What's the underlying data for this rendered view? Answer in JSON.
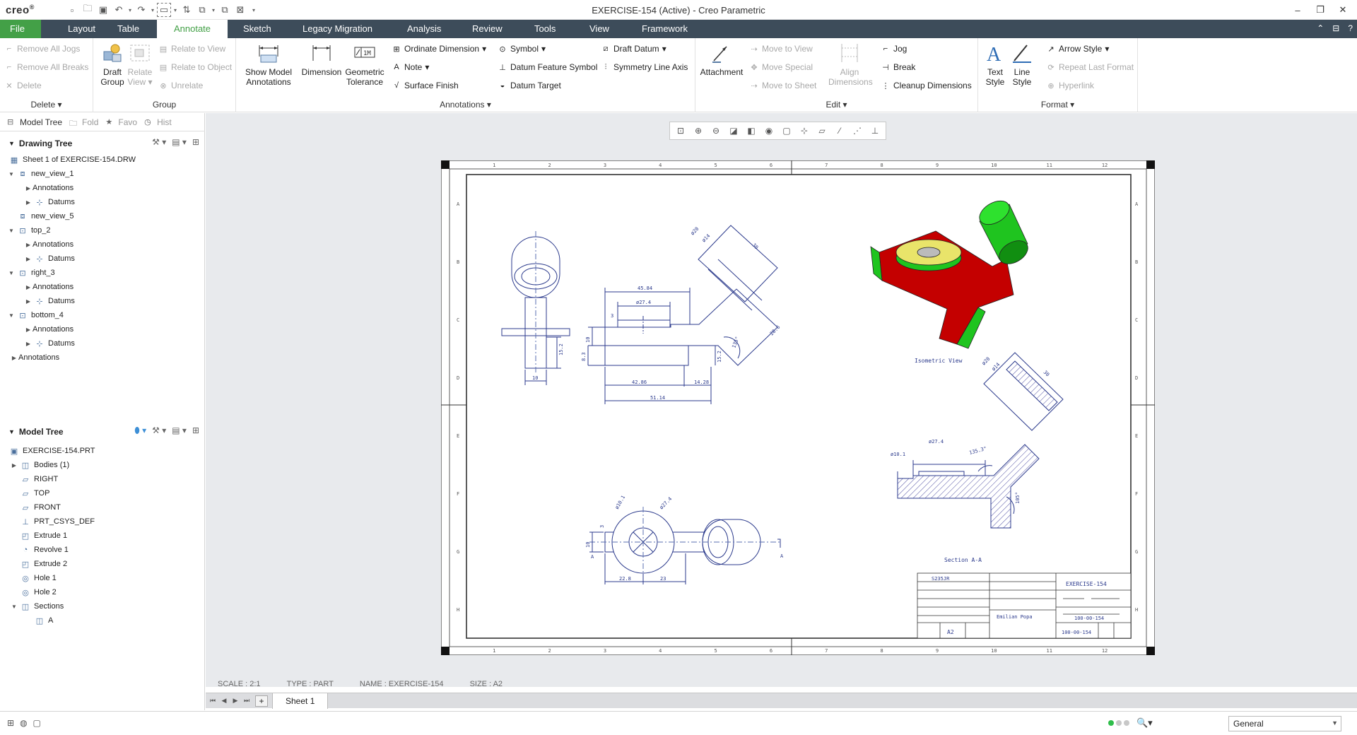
{
  "app": {
    "logo": "creo",
    "window_title": "EXERCISE-154 (Active) - Creo Parametric",
    "minimize": "–",
    "restore": "❐",
    "close": "✕"
  },
  "tabs": [
    "File",
    "Layout",
    "Table",
    "Annotate",
    "Sketch",
    "Legacy Migration",
    "Analysis",
    "Review",
    "Tools",
    "View",
    "Framework"
  ],
  "ribbon": {
    "delete_group": {
      "label": "Delete",
      "remove_all_jogs": "Remove All Jogs",
      "remove_all_breaks": "Remove All Breaks",
      "delete": "Delete"
    },
    "group_group": {
      "label": "Group",
      "draft_group": "Draft Group",
      "relate_view": "Relate View",
      "relate_to_view": "Relate to View",
      "relate_to_object": "Relate to Object",
      "unrelate": "Unrelate"
    },
    "annotations_group": {
      "label": "Annotations",
      "show_model_annotations": "Show Model Annotations",
      "dimension": "Dimension",
      "geometric_tolerance": "Geometric Tolerance",
      "ordinate_dimension": "Ordinate Dimension",
      "note": "Note",
      "surface_finish": "Surface Finish",
      "symbol": "Symbol",
      "datum_feature_symbol": "Datum Feature Symbol",
      "datum_target": "Datum Target",
      "draft_datum": "Draft Datum",
      "symmetry_line_axis": "Symmetry Line Axis"
    },
    "edit_group": {
      "label": "Edit",
      "attachment": "Attachment",
      "move_to_view": "Move to View",
      "move_special": "Move Special",
      "move_to_sheet": "Move to Sheet",
      "align_dimensions": "Align Dimensions",
      "jog": "Jog",
      "break": "Break",
      "cleanup_dimensions": "Cleanup Dimensions"
    },
    "format_group": {
      "label": "Format",
      "text_style": "Text Style",
      "line_style": "Line Style",
      "arrow_style": "Arrow Style",
      "repeat_last_format": "Repeat Last Format",
      "hyperlink": "Hyperlink"
    }
  },
  "navtabs": [
    "Model Tree",
    "Fold",
    "Favo",
    "Hist"
  ],
  "drawing_tree": {
    "title": "Drawing Tree",
    "items": [
      {
        "label": "Sheet 1 of EXERCISE-154.DRW"
      },
      {
        "label": "new_view_1"
      },
      {
        "label": "Annotations"
      },
      {
        "label": "Datums"
      },
      {
        "label": "new_view_5"
      },
      {
        "label": "top_2"
      },
      {
        "label": "Annotations"
      },
      {
        "label": "Datums"
      },
      {
        "label": "right_3"
      },
      {
        "label": "Annotations"
      },
      {
        "label": "Datums"
      },
      {
        "label": "bottom_4"
      },
      {
        "label": "Annotations"
      },
      {
        "label": "Datums"
      },
      {
        "label": "Annotations"
      }
    ]
  },
  "model_tree": {
    "title": "Model Tree",
    "items": [
      {
        "label": "EXERCISE-154.PRT"
      },
      {
        "label": "Bodies (1)"
      },
      {
        "label": "RIGHT"
      },
      {
        "label": "TOP"
      },
      {
        "label": "FRONT"
      },
      {
        "label": "PRT_CSYS_DEF"
      },
      {
        "label": "Extrude 1"
      },
      {
        "label": "Revolve 1"
      },
      {
        "label": "Extrude 2"
      },
      {
        "label": "Hole 1"
      },
      {
        "label": "Hole 2"
      },
      {
        "label": "Sections"
      },
      {
        "label": "A"
      }
    ]
  },
  "drawing": {
    "dims_top": [
      "ø20",
      "ø14",
      "30"
    ],
    "dims_front": [
      "45.84",
      "ø27.4",
      "3",
      "10",
      "8.3",
      "15.2",
      "42.86",
      "14.28",
      "51.14",
      "135°",
      "28.6"
    ],
    "dims_left": [
      "15.2",
      "10"
    ],
    "dims_bottom": [
      "ø10.1",
      "ø27.4",
      "3",
      "10",
      "22.8",
      "23",
      "A",
      "A"
    ],
    "dims_section": [
      "ø20",
      "ø14",
      "30",
      "ø10.1",
      "ø27.4",
      "135.3°",
      "105°"
    ],
    "isometric_label": "Isometric View",
    "section_label": "Section A-A",
    "title_block": {
      "material": "S235JR",
      "name": "EXERCISE-154",
      "number": "100-00-154",
      "number2": "100-00-154",
      "size": "A2",
      "author": "Emilian Popa"
    },
    "border_numbers": [
      "1",
      "2",
      "3",
      "4",
      "5",
      "6",
      "7",
      "8",
      "9",
      "10",
      "11",
      "12"
    ],
    "border_letters": [
      "A",
      "B",
      "C",
      "D",
      "E",
      "F",
      "G",
      "H"
    ]
  },
  "info": {
    "scale": "SCALE : 2:1",
    "type": "TYPE : PART",
    "name": "NAME : EXERCISE-154",
    "size": "SIZE : A2"
  },
  "sheet_tab": "Sheet 1",
  "status": {
    "filter": "General"
  },
  "colors": {
    "accent": "#43a047",
    "tabbar": "#3d4c5a",
    "iso_red": "#c40000",
    "iso_green": "#1fc41f",
    "iso_yellow": "#e9e46a"
  }
}
